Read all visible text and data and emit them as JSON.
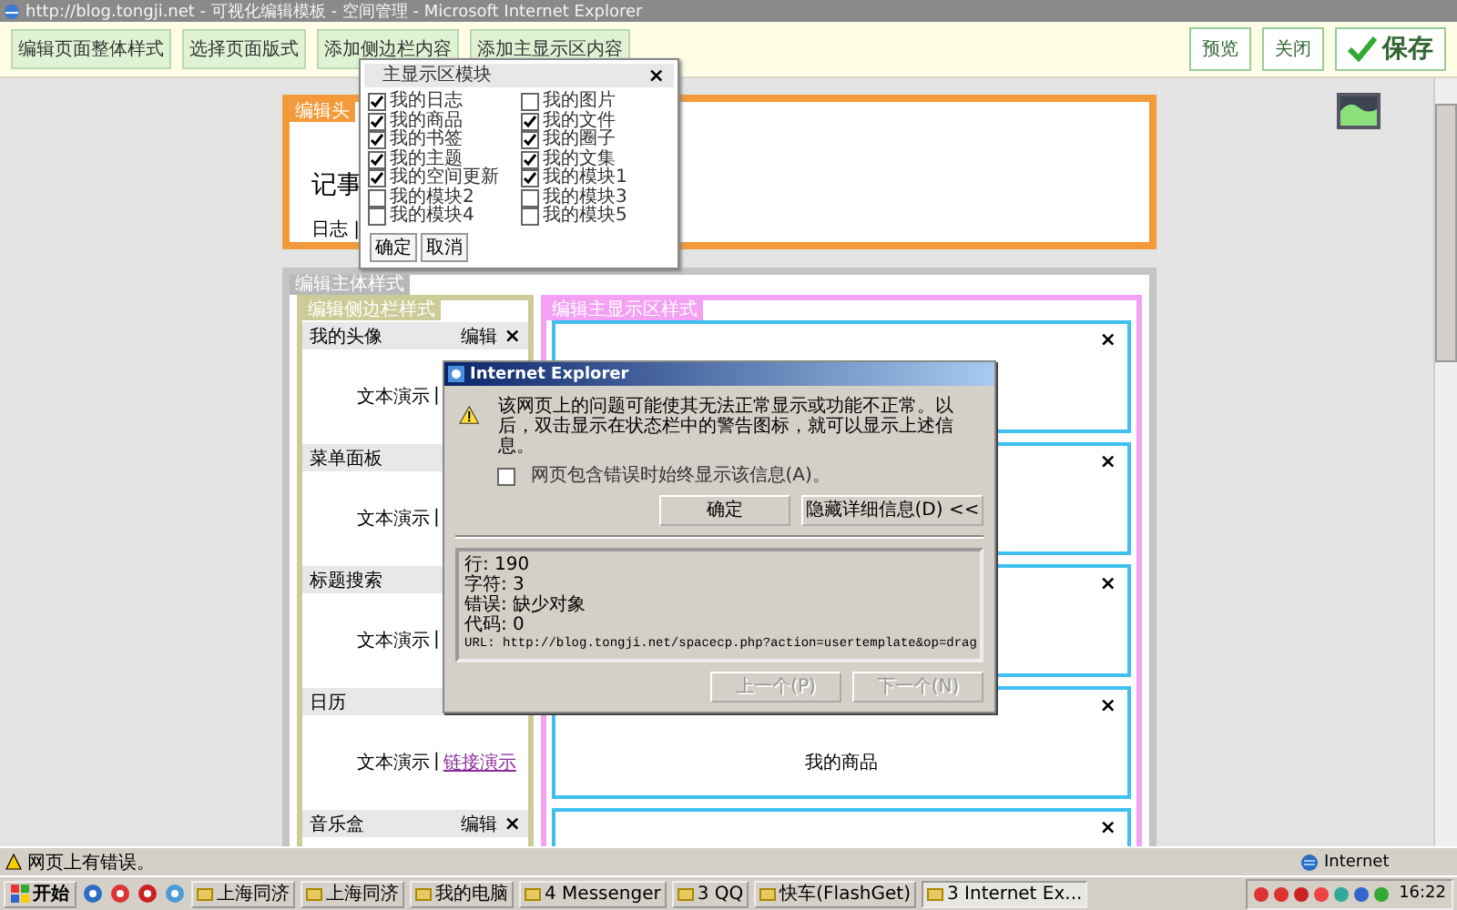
{
  "window": {
    "title": "http://blog.tongji.net - 可视化编辑模板 - 空间管理 - Microsoft Internet Explorer"
  },
  "toolbar": {
    "left_buttons": [
      "编辑页面整体样式",
      "选择页面版式",
      "添加侧边栏内容",
      "添加主显示区内容"
    ],
    "right_buttons": [
      {
        "label": "预览",
        "kind": "plain"
      },
      {
        "label": "关闭",
        "kind": "plain"
      },
      {
        "label": "保存",
        "kind": "primary"
      }
    ]
  },
  "module_picker": {
    "title": "主显示区模块",
    "close": "×",
    "columns": [
      [
        {
          "label": "我的日志",
          "checked": true
        },
        {
          "label": "我的商品",
          "checked": true
        },
        {
          "label": "我的书签",
          "checked": true
        },
        {
          "label": "我的主题",
          "checked": true
        },
        {
          "label": "我的空间更新",
          "checked": true
        },
        {
          "label": "我的模块2",
          "checked": false
        },
        {
          "label": "我的模块4",
          "checked": false
        }
      ],
      [
        {
          "label": "我的图片",
          "checked": false
        },
        {
          "label": "我的文件",
          "checked": true
        },
        {
          "label": "我的圈子",
          "checked": true
        },
        {
          "label": "我的文集",
          "checked": true
        },
        {
          "label": "我的模块1",
          "checked": true
        },
        {
          "label": "我的模块3",
          "checked": false
        },
        {
          "label": "我的模块5",
          "checked": false
        }
      ]
    ],
    "buttons": [
      "确定",
      "取消"
    ]
  },
  "header_section": {
    "label": "编辑头",
    "title": "记事",
    "nav": "日志 |"
  },
  "body_section": {
    "label": "编辑主体样式",
    "sidebar": {
      "label": "编辑侧边栏样式",
      "modules": [
        {
          "title": "我的头像",
          "edit": "编辑",
          "close": "×",
          "text": "文本演示",
          "separator": "|"
        },
        {
          "title": "菜单面板",
          "text": "文本演示",
          "separator": "|"
        },
        {
          "title": "标题搜索",
          "text": "文本演示",
          "separator": "|"
        },
        {
          "title": "日历",
          "text": "文本演示",
          "separator": "|",
          "link": "链接演示"
        },
        {
          "title": "音乐盒",
          "edit": "编辑",
          "close": "×"
        }
      ]
    },
    "main_area": {
      "label": "编辑主显示区样式",
      "blocks": [
        {
          "close": "×"
        },
        {
          "close": "×"
        },
        {
          "close": "×"
        },
        {
          "close": "×",
          "title": "我的商品"
        },
        {
          "close": "×"
        }
      ]
    }
  },
  "dialog": {
    "title": "Internet Explorer",
    "message": "该网页上的问题可能使其无法正常显示或功能不正常。以后，双击显示在状态栏中的警告图标，就可以显示上述信息。",
    "always_show": {
      "label": "网页包含错误时始终显示该信息(A)。",
      "checked": false
    },
    "buttons": [
      {
        "label": "确定",
        "disabled": false
      },
      {
        "label": "隐藏详细信息(D) <<",
        "disabled": false
      }
    ],
    "details": [
      "行:  190",
      "字符: 3",
      "错误: 缺少对象",
      "代码: 0",
      "URL: http://blog.tongji.net/spacecp.php?action=usertemplate&op=drag"
    ],
    "nav_buttons": [
      {
        "label": "上一个(P)",
        "disabled": true
      },
      {
        "label": "下一个(N)",
        "disabled": true
      }
    ]
  },
  "status_bar": {
    "message": "网页上有错误。",
    "zone": "Internet"
  },
  "taskbar": {
    "start": "开始",
    "tasks": [
      {
        "label": "上海同济",
        "selected": false
      },
      {
        "label": "上海同济",
        "selected": false
      },
      {
        "label": "我的电脑",
        "selected": false
      },
      {
        "label": "4 Messenger",
        "selected": false
      },
      {
        "label": "3 QQ",
        "selected": false
      },
      {
        "label": "快车(FlashGet)",
        "selected": false
      },
      {
        "label": "3 Internet Ex...",
        "selected": true
      }
    ],
    "clock": "16:22"
  }
}
